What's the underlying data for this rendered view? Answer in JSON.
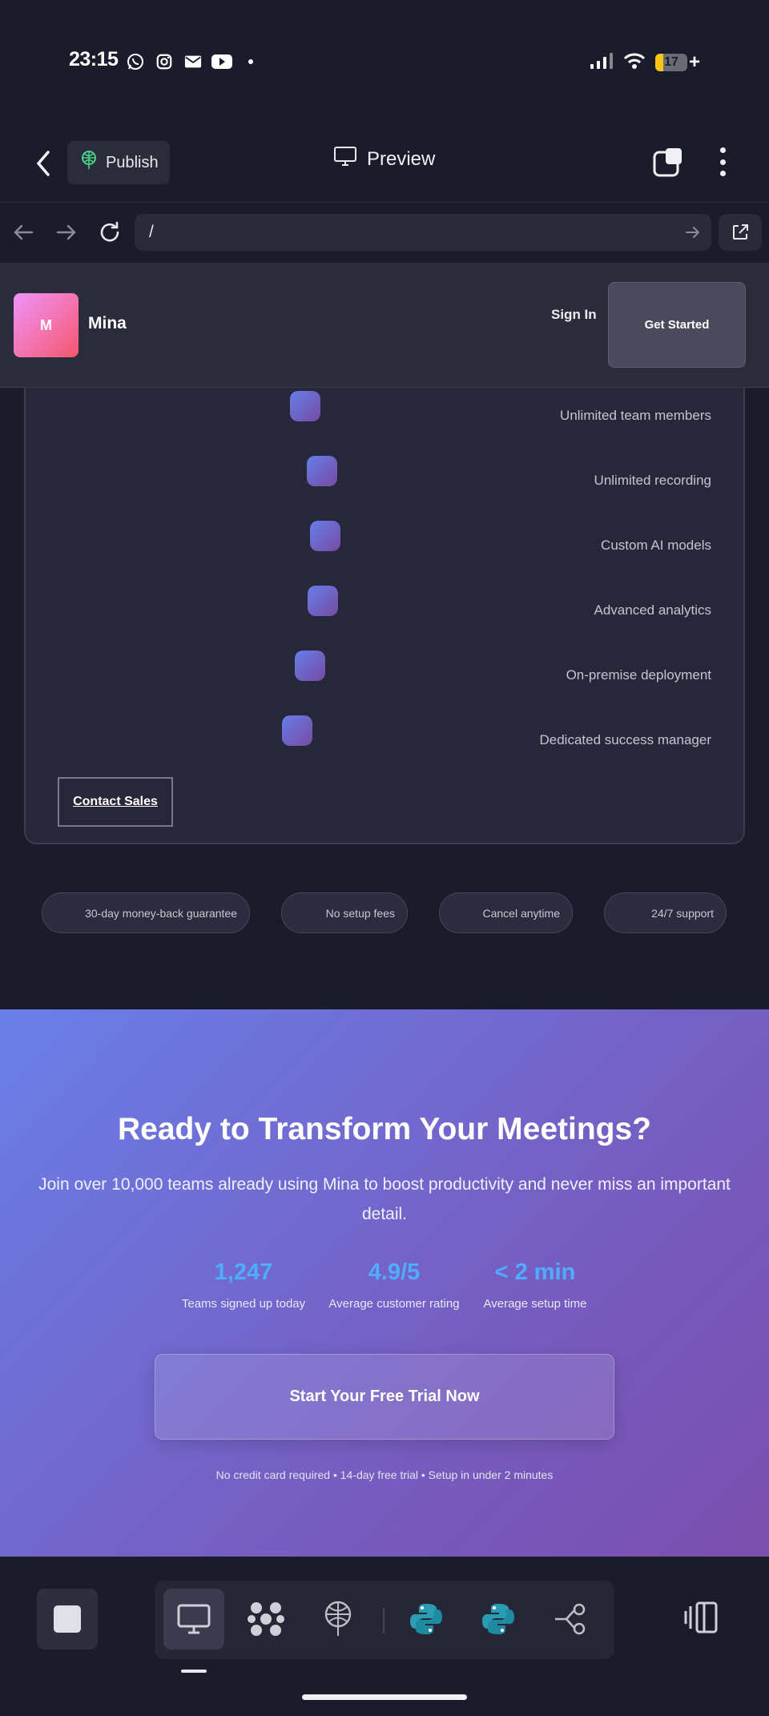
{
  "status_bar": {
    "time": "23:15",
    "battery": "17"
  },
  "app_bar": {
    "publish_label": "Publish",
    "preview_label": "Preview"
  },
  "url_bar": {
    "url": "/"
  },
  "site_header": {
    "logo_letter": "M",
    "brand": "Mina",
    "sign_in": "Sign In",
    "get_started": "Get Started"
  },
  "pricing": {
    "features": [
      "Unlimited team members",
      "Unlimited recording",
      "Custom AI models",
      "Advanced analytics",
      "On-premise deployment",
      "Dedicated success manager"
    ],
    "contact_label": "Contact Sales"
  },
  "trust_badges": [
    "30-day money-back guarantee",
    "No setup fees",
    "Cancel anytime",
    "24/7 support"
  ],
  "cta": {
    "title": "Ready to Transform Your Meetings?",
    "subtitle": "Join over 10,000 teams already using Mina to boost productivity and never miss an important detail.",
    "stats": [
      {
        "value": "1,247",
        "label": "Teams signed up today"
      },
      {
        "value": "4.9/5",
        "label": "Average customer rating"
      },
      {
        "value": "< 2 min",
        "label": "Average setup time"
      }
    ],
    "button_label": "Start Your Free Trial Now",
    "fineprint": "No credit card required • 14-day free trial • Setup in under 2 minutes"
  },
  "colors": {
    "accent_gradient_start": "#667eea",
    "accent_gradient_end": "#764ba2",
    "stat_color": "#4facfe",
    "logo_gradient_start": "#f093fb",
    "logo_gradient_end": "#f5576c"
  },
  "icons": [
    "whatsapp-icon",
    "instagram-icon",
    "mail-icon",
    "youtube-icon",
    "signal-icon",
    "wifi-icon",
    "battery-icon",
    "back-icon",
    "publish-icon",
    "monitor-icon",
    "tabs-icon",
    "more-icon",
    "nav-back-icon",
    "nav-forward-icon",
    "reload-icon",
    "go-icon",
    "external-link-icon",
    "stop-icon",
    "desktop-icon",
    "apps-icon",
    "deploy-icon",
    "python-icon",
    "flow-icon",
    "panel-icon"
  ]
}
